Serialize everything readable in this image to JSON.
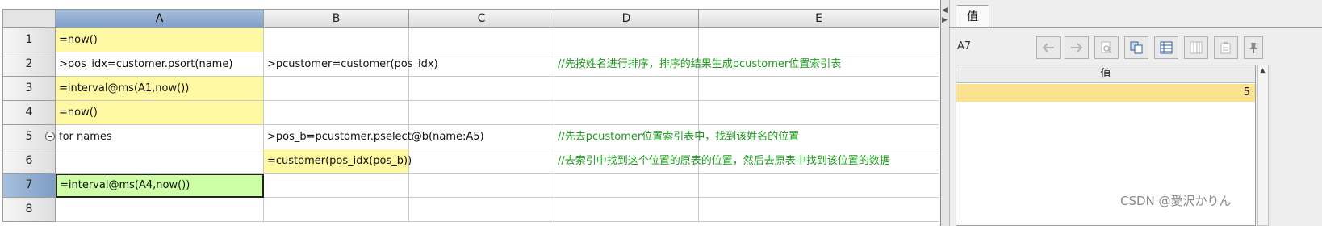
{
  "sheet": {
    "columns": [
      "A",
      "B",
      "C",
      "D",
      "E"
    ],
    "rows": [
      "1",
      "2",
      "3",
      "4",
      "5",
      "6",
      "7",
      "8"
    ],
    "cells": {
      "a1": "=now()",
      "a2": ">pos_idx=customer.psort(name)",
      "b2": ">pcustomer=customer(pos_idx)",
      "d2": "//先按姓名进行排序，排序的结果生成pcustomer位置索引表",
      "a3": "=interval@ms(A1,now())",
      "a4": "=now()",
      "a5": "for names",
      "b5": ">pos_b=pcustomer.pselect@b(name:A5)",
      "d5": "//先去pcustomer位置索引表中，找到该姓名的位置",
      "b6": "=customer(pos_idx(pos_b))",
      "d6": "//去索引中找到这个位置的原表的位置，然后去原表中找到该位置的数据",
      "a7": "=interval@ms(A4,now())"
    }
  },
  "panel": {
    "tab_label": "值",
    "cell_ref": "A7",
    "column_header": "值",
    "value": "5",
    "toolbar": [
      "back-icon",
      "forward-icon",
      "zoom-icon",
      "copy-icon",
      "table-view-icon",
      "column-view-icon",
      "clipboard-icon",
      "pin-icon"
    ]
  },
  "watermark": "CSDN @愛沢かりん",
  "colors": {
    "header_selected": "#a9c0dd",
    "yellow_cell": "#fff9a3",
    "green_cell": "#ccffa6",
    "comment_text": "#1d9a1d",
    "value_highlight": "#fbe28e"
  }
}
